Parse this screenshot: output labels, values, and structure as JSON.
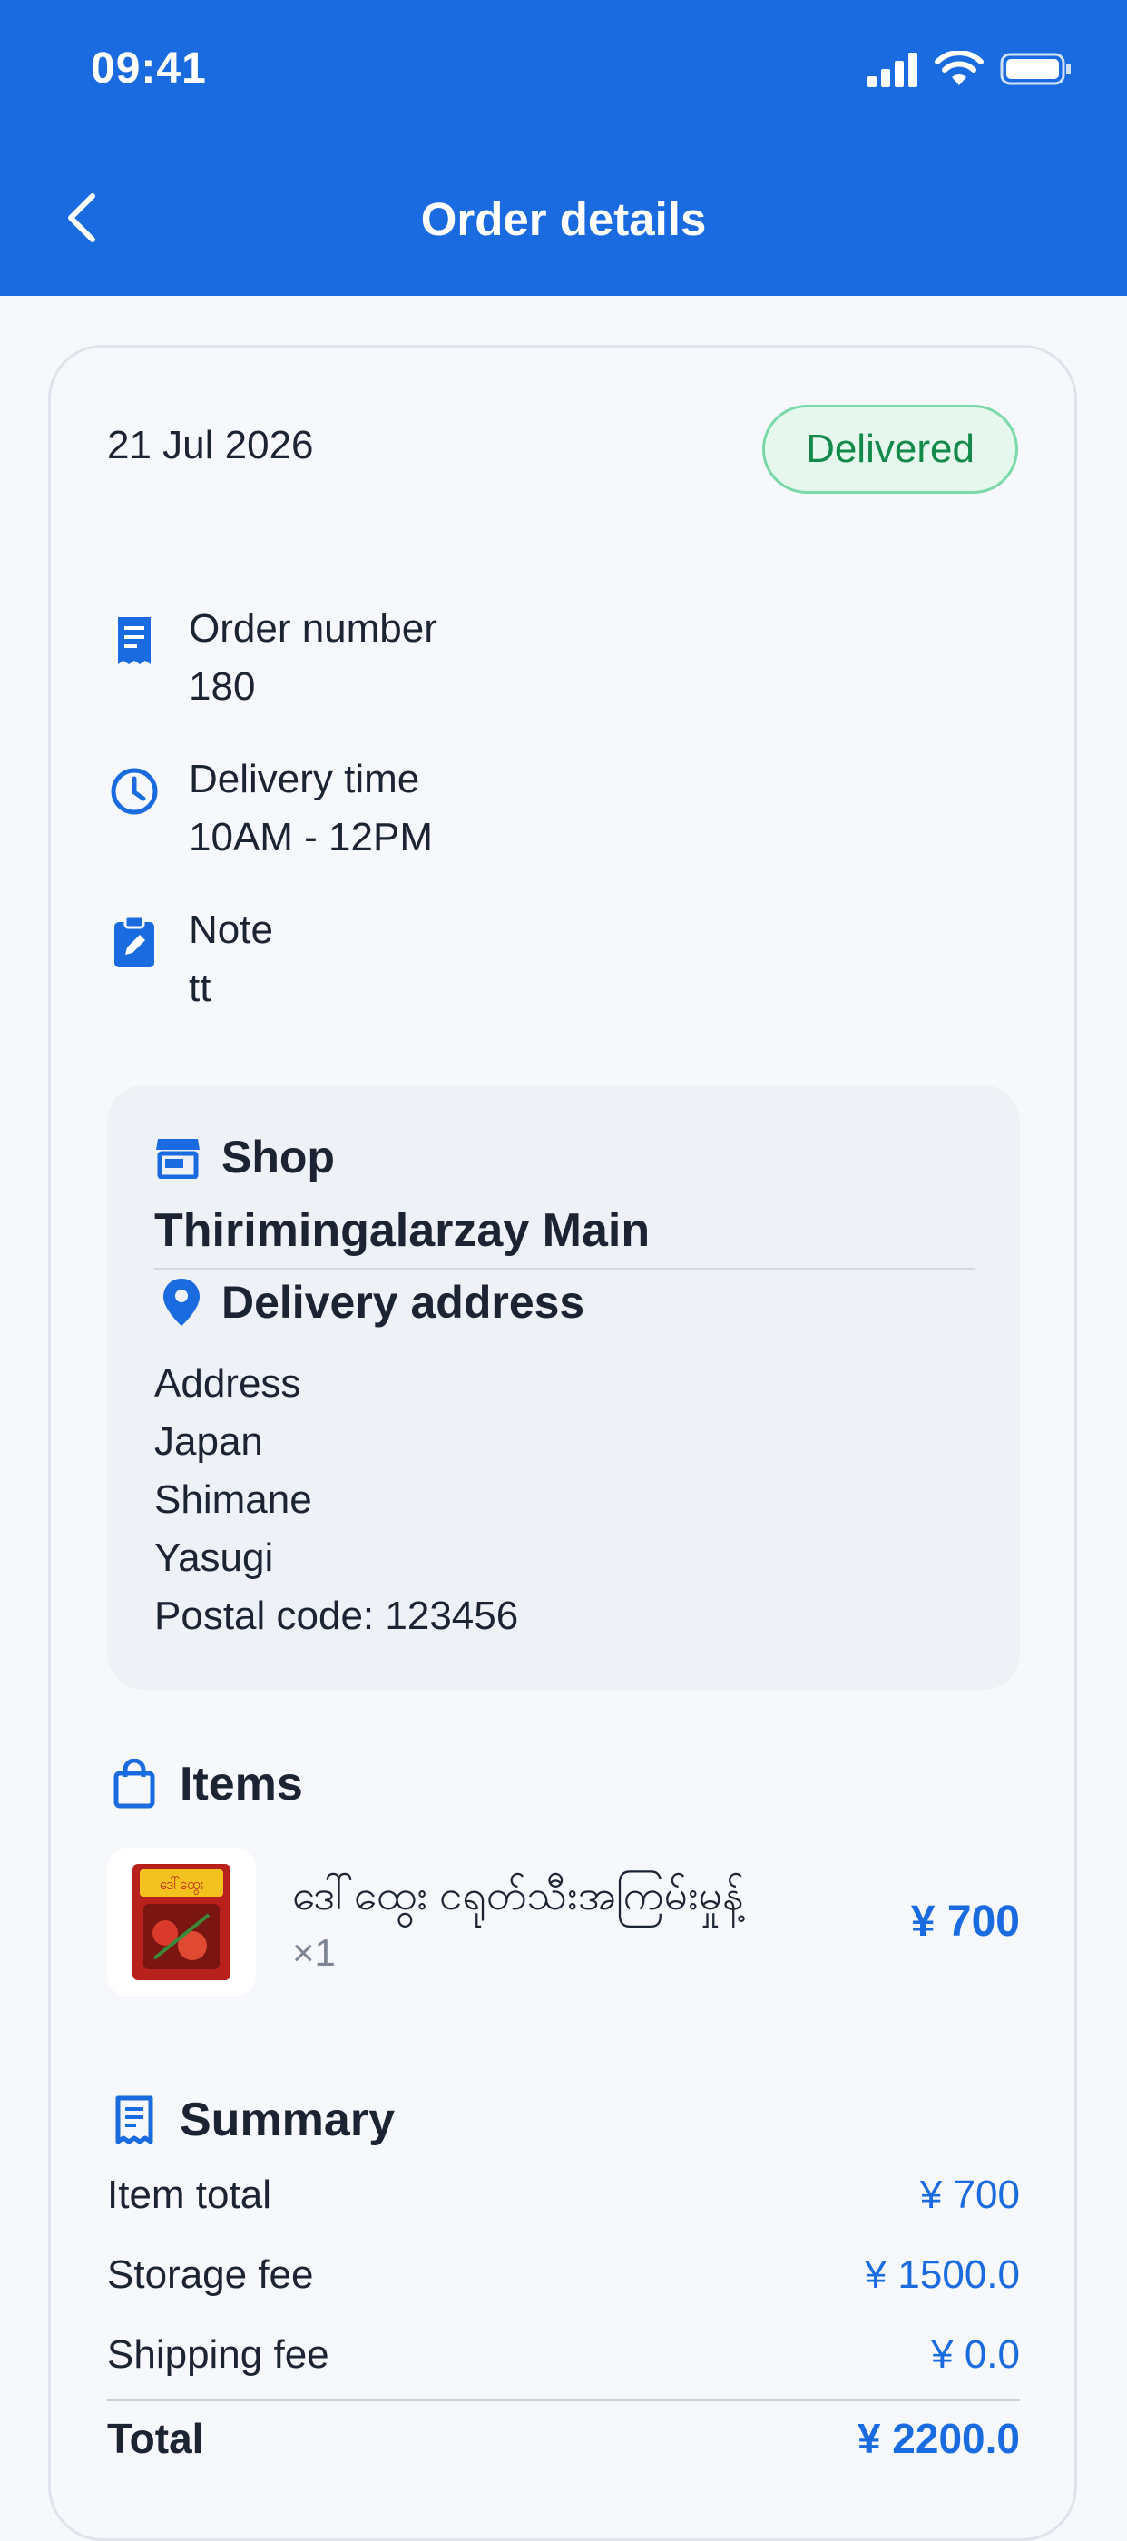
{
  "status_bar": {
    "time": "09:41"
  },
  "header": {
    "title": "Order details"
  },
  "order": {
    "date": "21 Jul 2026",
    "status": "Delivered",
    "order_number_label": "Order number",
    "order_number": "180",
    "delivery_time_label": "Delivery time",
    "delivery_time": "10AM - 12PM",
    "note_label": "Note",
    "note": "tt"
  },
  "shop": {
    "heading": "Shop",
    "name": "Thirimingalarzay Main"
  },
  "delivery_address": {
    "heading": "Delivery address",
    "lines": [
      "Address",
      "Japan",
      "Shimane",
      "Yasugi",
      "Postal code: 123456"
    ]
  },
  "items": {
    "heading": "Items",
    "list": [
      {
        "name": "ဒေါ်ထွေး ငရုတ်သီးအကြမ်းမှုန့်",
        "qty": "×1",
        "price": "¥ 700",
        "image_label": "ဒေါ်ထွေး"
      }
    ]
  },
  "summary": {
    "heading": "Summary",
    "rows": [
      {
        "label": "Item total",
        "value": "¥ 700"
      },
      {
        "label": "Storage fee",
        "value": "¥ 1500.0"
      },
      {
        "label": "Shipping fee",
        "value": "¥ 0.0"
      }
    ],
    "total_label": "Total",
    "total_value": "¥ 2200.0"
  },
  "colors": {
    "primary": "#1a6be0",
    "status_green": "#138a4a",
    "badge_bg": "#e6f7ee"
  },
  "icons": [
    "back-icon",
    "receipt-icon",
    "clock-icon",
    "clipboard-edit-icon",
    "store-icon",
    "location-pin-icon",
    "shopping-bag-icon",
    "signal-icon",
    "wifi-icon",
    "battery-icon"
  ]
}
